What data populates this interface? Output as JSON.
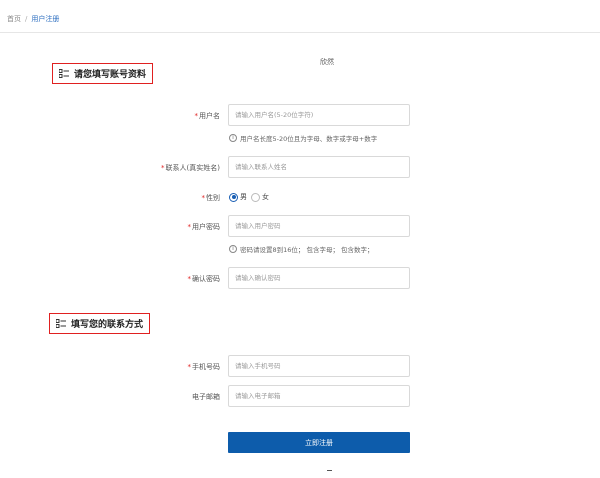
{
  "breadcrumb": {
    "home": "首页",
    "separator": "/",
    "current": "用户注册"
  },
  "floating_text": "欣然",
  "sections": {
    "account": {
      "title": "请您填写账号资料",
      "icon": "list-icon"
    },
    "contact": {
      "title": "填写您的联系方式",
      "icon": "list-icon"
    }
  },
  "fields": {
    "username": {
      "label": "用户名",
      "required": "*",
      "placeholder": "请输入用户名(5-20位字符)",
      "hint": "用户名长度5-20位且为字母、数字或字母+数字"
    },
    "contact_name": {
      "label": "联系人(真实姓名)",
      "required": "*",
      "placeholder": "请输入联系人姓名"
    },
    "gender": {
      "label": "性别",
      "required": "*",
      "options": [
        "男",
        "女"
      ],
      "selected": "男"
    },
    "password": {
      "label": "用户密码",
      "required": "*",
      "placeholder": "请输入用户密码",
      "hint": "密码请设置8到16位；  包含字母；  包含数字；"
    },
    "confirm_password": {
      "label": "确认密码",
      "required": "*",
      "placeholder": "请输入确认密码"
    },
    "phone": {
      "label": "手机号码",
      "required": "*",
      "placeholder": "请输入手机号码"
    },
    "email": {
      "label": "电子邮箱",
      "placeholder": "请输入电子邮箱"
    }
  },
  "submit_label": "立即注册",
  "info_glyph": "i",
  "colors": {
    "accent": "#0d5cab",
    "required": "#e02020",
    "highlight_border": "#e02020"
  }
}
